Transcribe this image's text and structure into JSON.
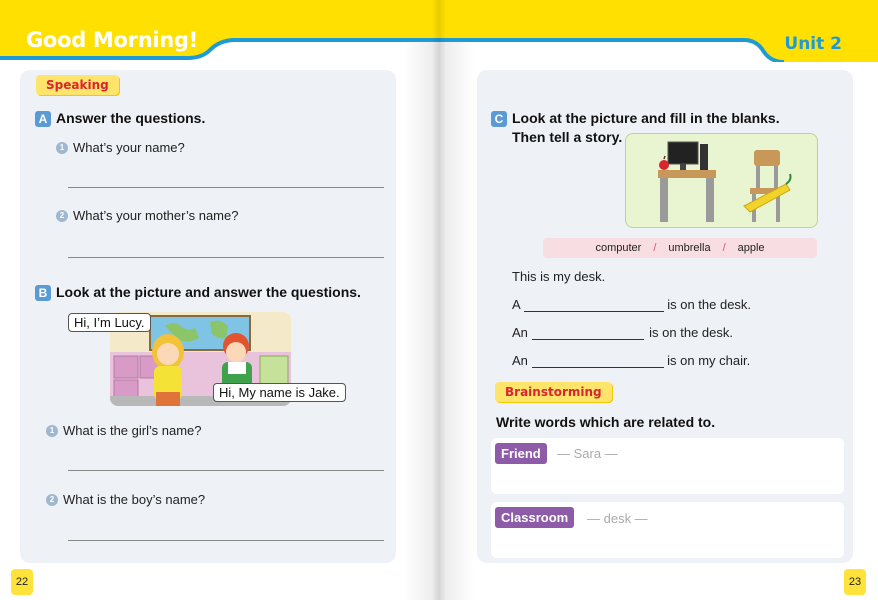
{
  "left_page": {
    "title": "Good Morning!",
    "speaking_tag": "Speaking",
    "section_a": {
      "letter": "A",
      "title": "Answer the questions.",
      "questions": [
        {
          "num": "1",
          "text": "What’s your name?"
        },
        {
          "num": "2",
          "text": "What’s your mother’s name?"
        }
      ]
    },
    "section_b": {
      "letter": "B",
      "title": "Look at the picture and answer the questions.",
      "bubble_girl": "Hi, I’m Lucy.",
      "bubble_boy": "Hi, My name is Jake.",
      "questions": [
        {
          "num": "1",
          "text": "What is the girl’s name?"
        },
        {
          "num": "2",
          "text": "What is the boy’s name?"
        }
      ]
    },
    "page_number": "22"
  },
  "right_page": {
    "unit_title": "Unit 2",
    "section_c": {
      "letter": "C",
      "title_line1": "Look at the picture and fill in the blanks.",
      "title_line2": "Then tell a story."
    },
    "word_bank": [
      "computer",
      "umbrella",
      "apple"
    ],
    "word_separator": "/",
    "sentences": {
      "s1": "This is my desk.",
      "s2_pre": "A",
      "s2_post": "is on the desk.",
      "s3_pre": "An",
      "s3_post": "is on the desk.",
      "s4_pre": "An",
      "s4_post": "is on my chair."
    },
    "brainstorming_tag": "Brainstorming",
    "brainstorm_instruction": "Write words which are related to.",
    "brainstorm_items": [
      {
        "label": "Friend",
        "example": "—   Sara   —"
      },
      {
        "label": "Classroom",
        "example": "—   desk   —"
      }
    ],
    "page_number": "23"
  },
  "colors": {
    "banner_yellow": "#ffe000",
    "banner_blue": "#1e9ad6",
    "panel_bg": "#eef1f6",
    "tag_red": "#d9262e",
    "chip_purple": "#8e5ba8",
    "word_bar_pink": "#f8dde2"
  }
}
